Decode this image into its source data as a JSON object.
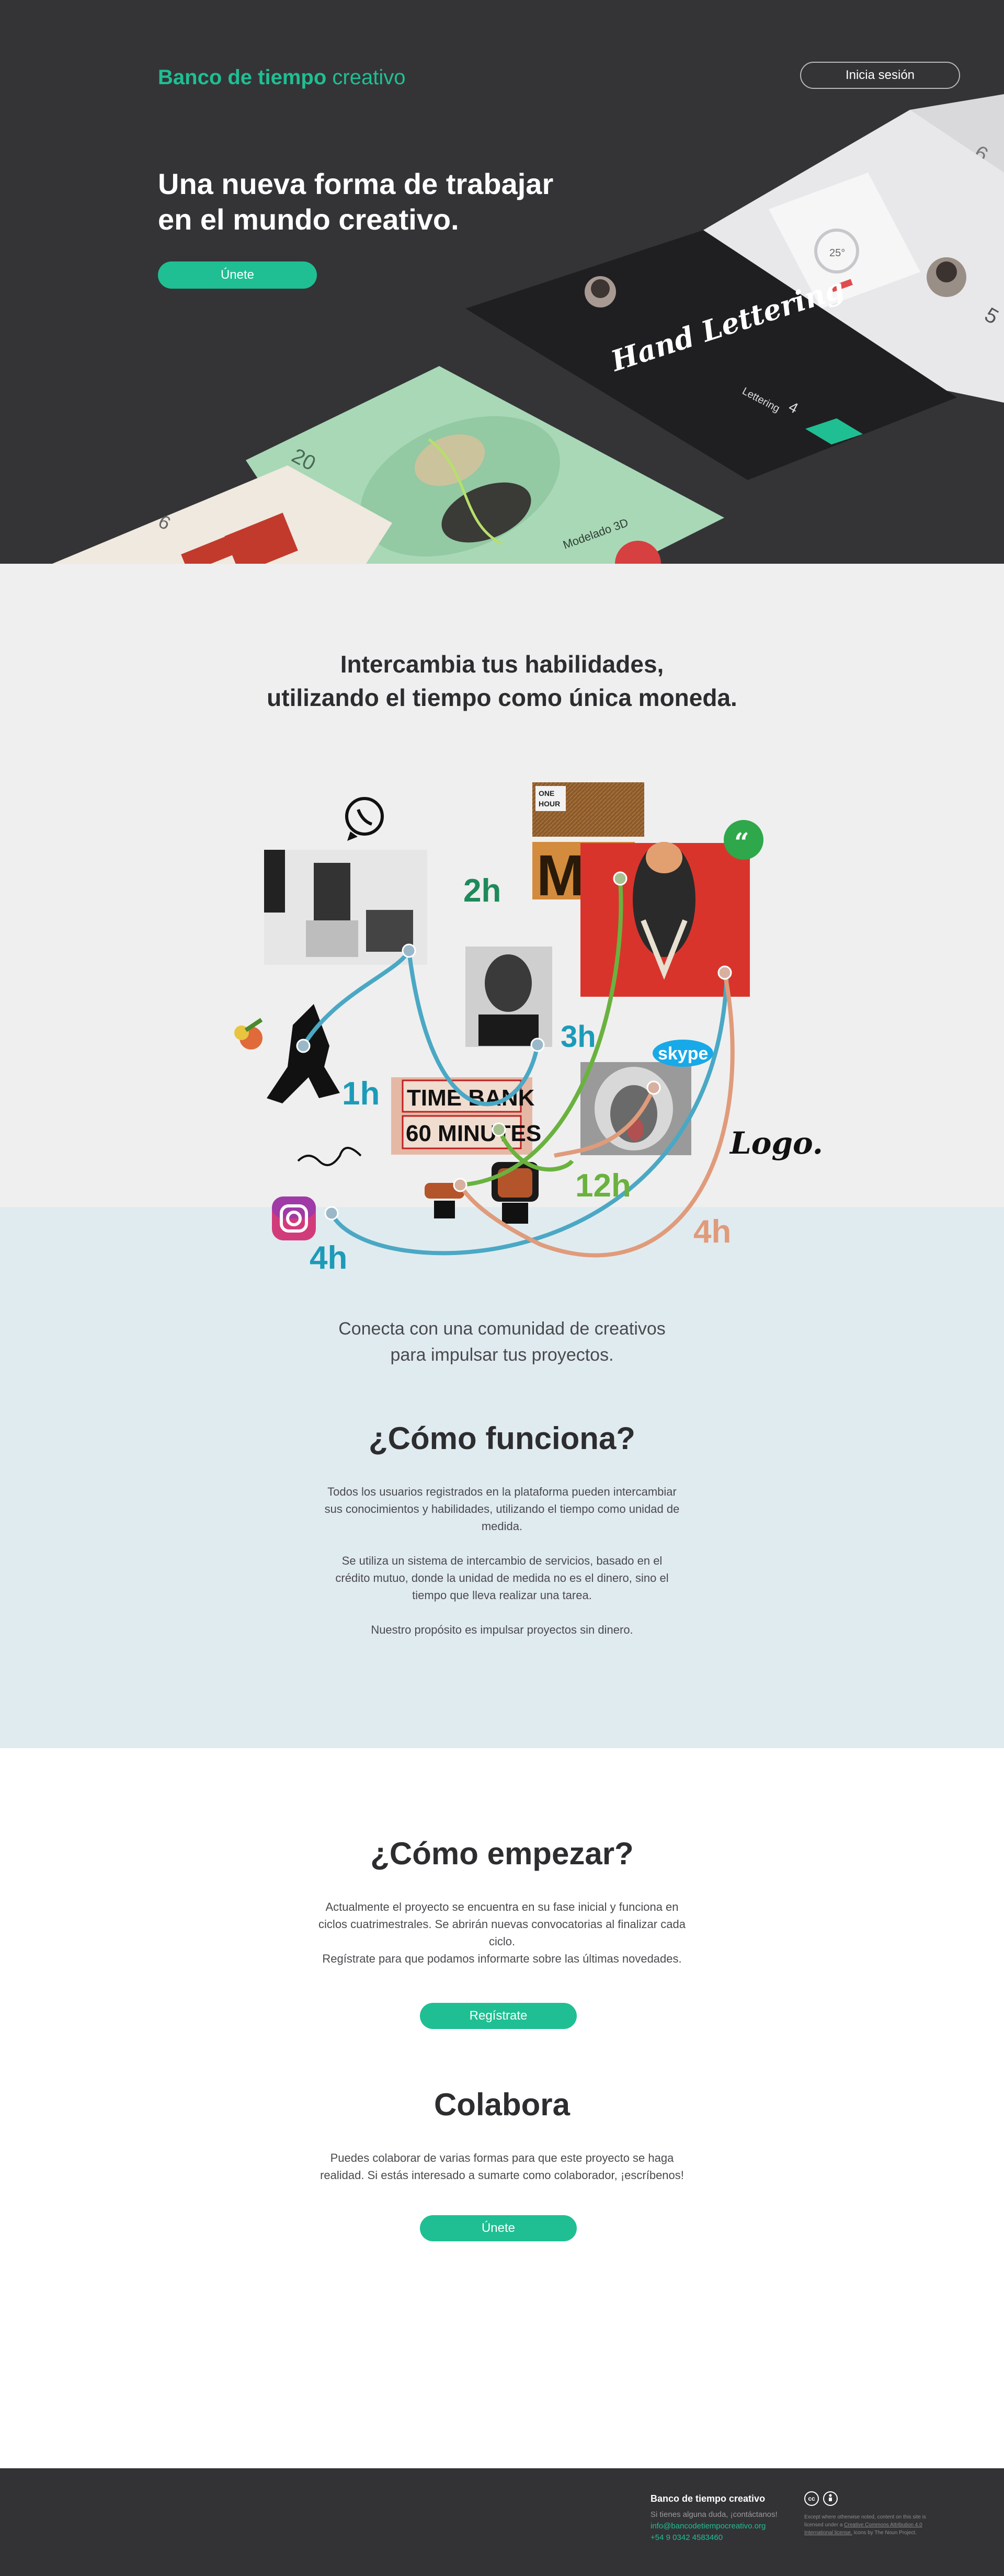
{
  "header": {
    "brand_bold": "Banco de tiempo",
    "brand_light": "creativo",
    "login_label": "Inicia sesión"
  },
  "hero": {
    "title_line1": "Una nueva forma de trabajar",
    "title_line2": "en el mundo creativo.",
    "join_label": "Únete",
    "mockup_card_lettering": "Hand Lettering",
    "mockup_lettering_label": "Lettering",
    "mockup_lettering_hours": "4",
    "mockup_modelado_label": "Modelado 3D",
    "mockup_modelado_hours": "20",
    "mockup_left_hours": "6",
    "mockup_right_hours": "6",
    "mockup_far_right_hours": "5",
    "mockup_temp": "25°"
  },
  "exchange": {
    "title_line1": "Intercambia tus habilidades,",
    "title_line2": "utilizando el tiempo como única moneda.",
    "hours": [
      "2h",
      "3h",
      "1h",
      "12h",
      "4h",
      "4h"
    ],
    "one_hour_label_1": "ONE",
    "one_hour_label_2": "HOUR",
    "me_label": "ME",
    "timebank_line1": "TIME BANK",
    "timebank_line2": "60 MINUTES",
    "skype_label": "skype",
    "logo_label": "Logo.",
    "connect_line1": "Conecta con una comunidad de creativos",
    "connect_line2": "para impulsar tus proyectos."
  },
  "how": {
    "title": "¿Cómo funciona?",
    "p1": "Todos los usuarios registrados en la plataforma pueden intercambiar sus conocimientos y habilidades, utilizando el tiempo como unidad de medida.",
    "p2": "Se utiliza un sistema de intercambio de servicios, basado en el crédito mutuo, donde la unidad de medida no es el dinero, sino el tiempo que lleva realizar una tarea.",
    "p3": "Nuestro propósito es impulsar proyectos sin dinero."
  },
  "start": {
    "title": "¿Cómo empezar?",
    "text1": "Actualmente el proyecto se encuentra en su fase inicial y funciona en ciclos cuatrimestrales. Se abrirán nuevas convocatorias al finalizar cada ciclo.",
    "text2": "Regístrate para que podamos informarte sobre las últimas novedades.",
    "register_label": "Regístrate"
  },
  "collaborate": {
    "title": "Colabora",
    "text": "Puedes colaborar de varias formas para que este proyecto se haga realidad. Si estás interesado a sumarte como colaborador, ¡escríbenos!",
    "join_label": "Únete"
  },
  "footer": {
    "title": "Banco de tiempo creativo",
    "line1": "Si tienes alguna duda, ¡contáctanos!",
    "email": "info@bancodetiempocreativo.org",
    "phone": "+54 9 0342 4583460",
    "cc_label": "cc",
    "license_prefix": "Except where otherwise noted, content on this site is licensed under a",
    "license_link": "Creative Commons Attribution 4.0 International license.",
    "license_icons": "Icons by The Noun Project."
  },
  "colors": {
    "accent": "#1fbf93",
    "hero_bg": "#343437",
    "grey_bg": "#efefef",
    "blue_bg": "#e0ebf0",
    "footer_bg": "#333336",
    "curve_blue": "#4aa8c4",
    "curve_green": "#6ab23f",
    "curve_orange": "#e09b7b",
    "hour_teal": "#1c9bb8",
    "hour_green": "#1e8a5a"
  }
}
